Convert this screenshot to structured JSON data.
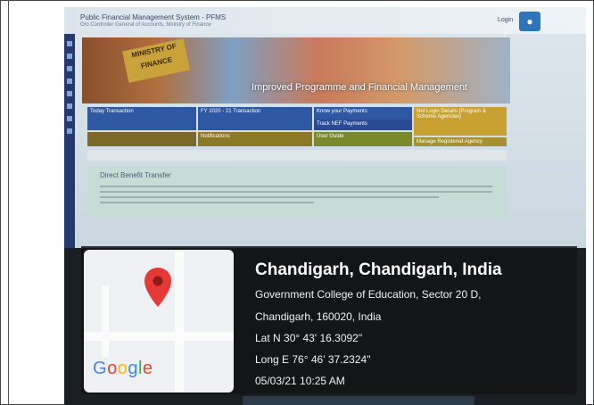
{
  "app": {
    "title": "Public Financial Management System - PFMS",
    "subtitle": "O/o Controller General of Accounts, Ministry of Finance",
    "login_label": "Login"
  },
  "banner": {
    "sign_text": "MINISTRY OF FINANCE",
    "caption": "Improved Programme and Financial Management"
  },
  "tiles": {
    "today": "Today Transaction",
    "fy": "FY 2020 - 21 Transaction",
    "know_payments": "Know your Payments",
    "track_npf": "Track NEF Payments",
    "state_login": "Not Login Details (Program & Scheme Agencies)",
    "notice": "Notifications",
    "user_guide": "User Guide",
    "manage": "Manage Registered Agency"
  },
  "dbt": {
    "title": "Direct Benefit Transfer"
  },
  "geotag": {
    "location_title": "Chandigarh, Chandigarh, India",
    "address_line1": "Government College of Education, Sector 20 D,",
    "address_line2": "Chandigarh, 160020, India",
    "latitude": "Lat N 30° 43' 16.3092\"",
    "longitude": "Long E 76° 46' 37.2324\"",
    "timestamp": "05/03/21 10:25 AM",
    "map_brand": "Google"
  }
}
